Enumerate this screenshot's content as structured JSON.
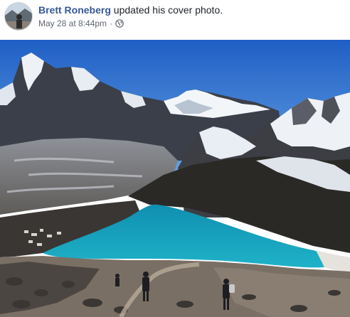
{
  "post": {
    "author": "Brett Roneberg",
    "action": "updated his cover photo.",
    "timestamp": "May 28 at 8:44pm",
    "separator": "·",
    "privacy_icon": "globe-icon"
  },
  "photo": {
    "subject": "mountain-lake-landscape",
    "colors": {
      "sky": "#2f6fd0",
      "lake": "#1aa0b8",
      "snow": "#f2f5f8",
      "rock": "#4a4642"
    }
  }
}
